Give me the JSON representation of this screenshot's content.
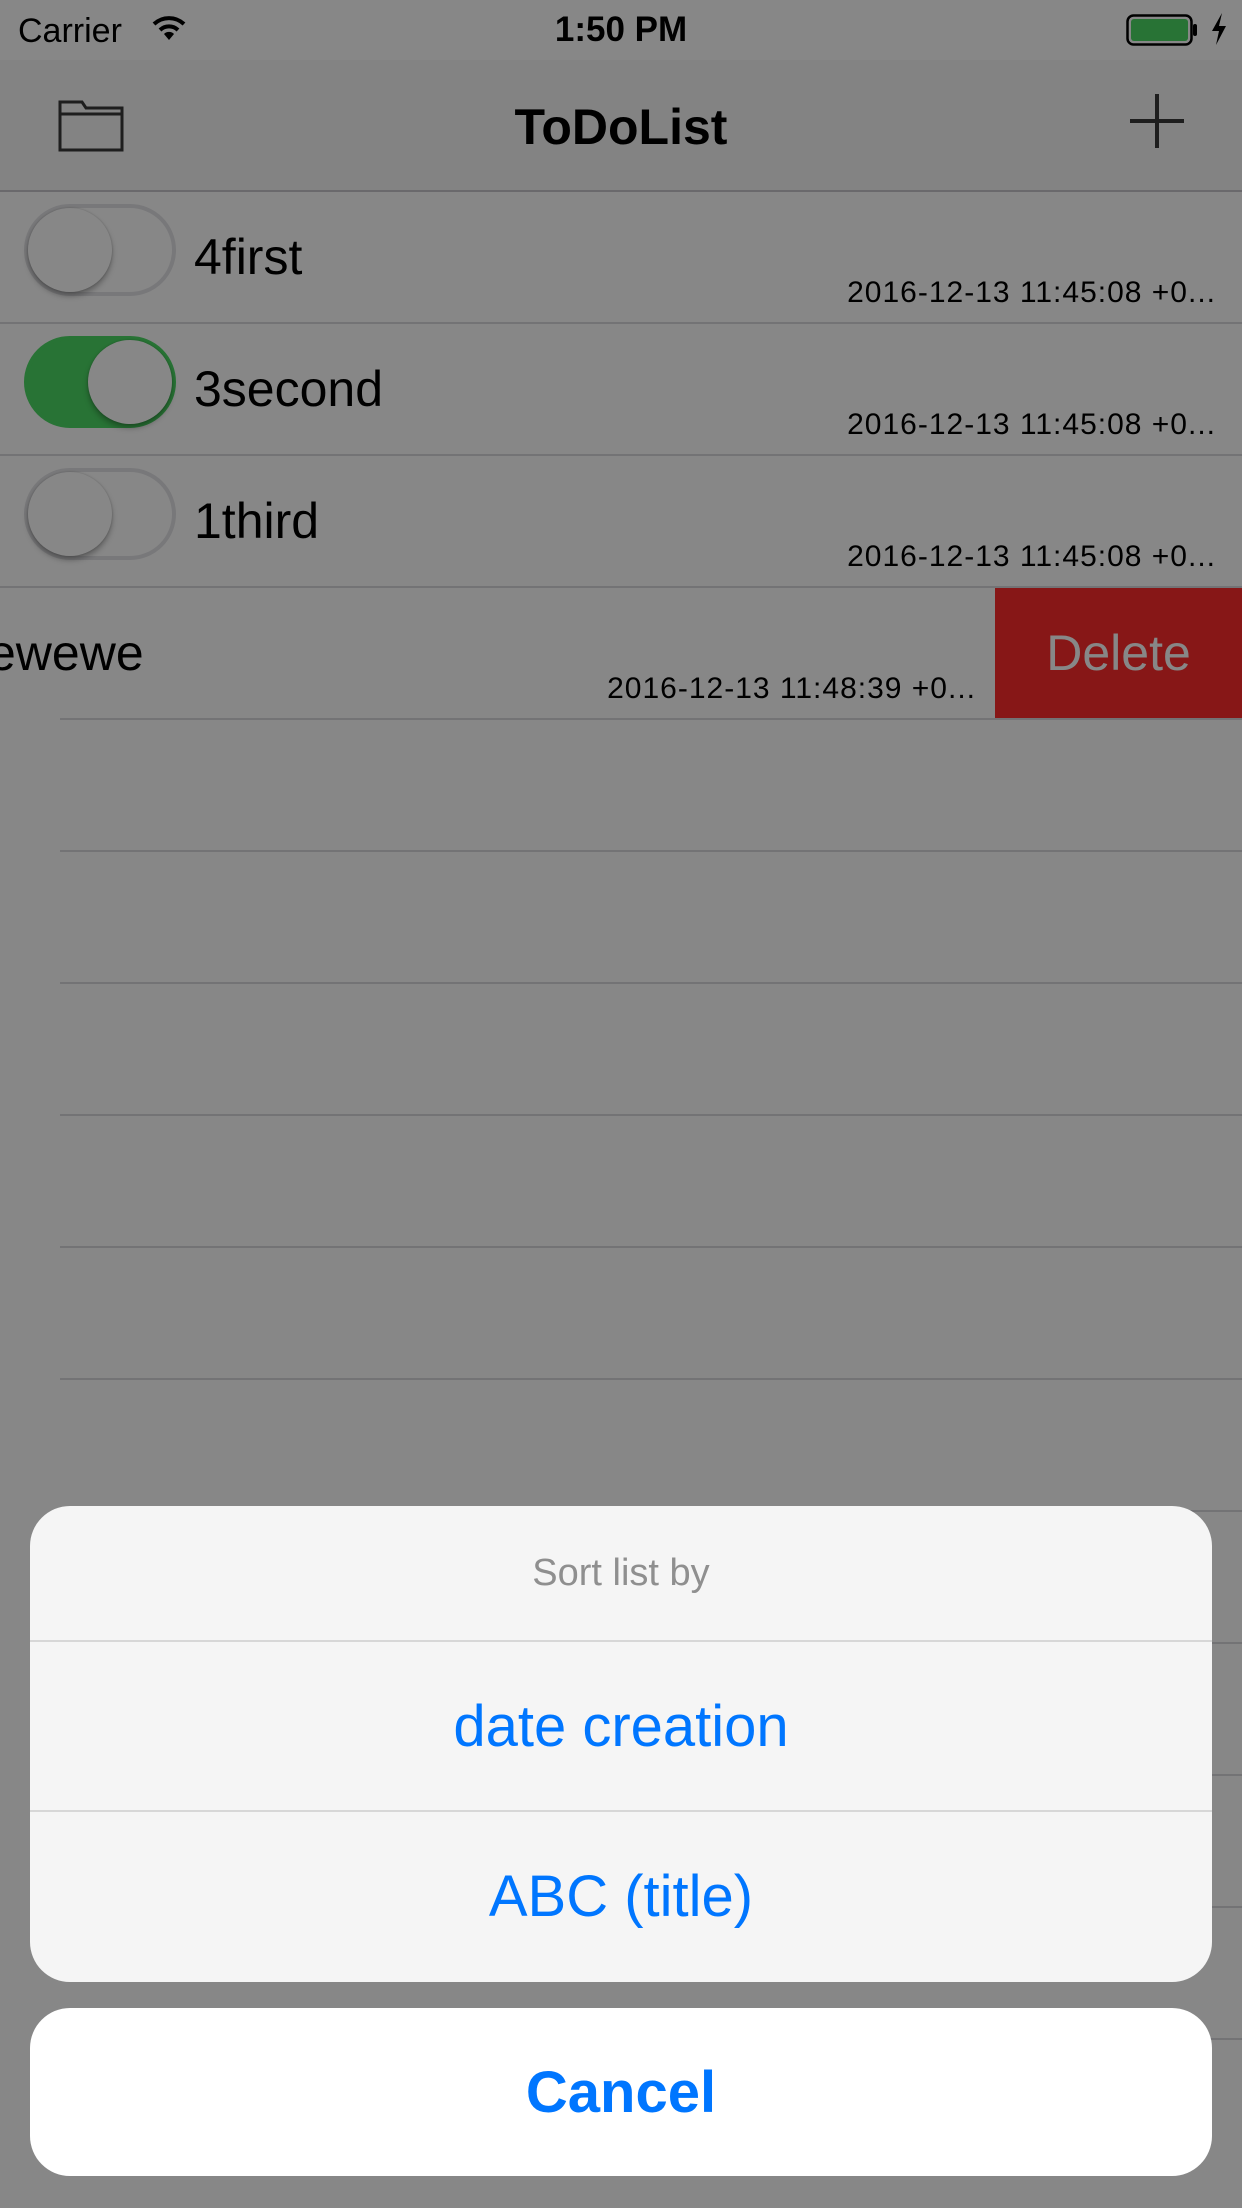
{
  "status_bar": {
    "carrier": "Carrier",
    "time": "1:50 PM",
    "icons": [
      "wifi-icon",
      "battery-icon",
      "charging-icon"
    ]
  },
  "nav_bar": {
    "title": "ToDoList",
    "left_icon": "folder-icon",
    "right_icon": "add-icon"
  },
  "todos": [
    {
      "title": "4first",
      "date": "2016-12-13 11:45:08 +0...",
      "done": false
    },
    {
      "title": "3second",
      "date": "2016-12-13 11:45:08 +0...",
      "done": true
    },
    {
      "title": "1third",
      "date": "2016-12-13 11:45:08 +0...",
      "done": false
    },
    {
      "title": "ewewe",
      "date": "2016-12-13 11:48:39 +0...",
      "swiped": true
    }
  ],
  "row_actions": {
    "delete_label": "Delete"
  },
  "action_sheet": {
    "title": "Sort list by",
    "options": [
      "date creation",
      "ABC (title)"
    ],
    "cancel_label": "Cancel"
  },
  "colors": {
    "switch_on": "#4cd964",
    "delete_red": "#ff2d2d",
    "action_blue": "#0076ff",
    "overlay": "rgba(0,0,0,0.47)"
  }
}
